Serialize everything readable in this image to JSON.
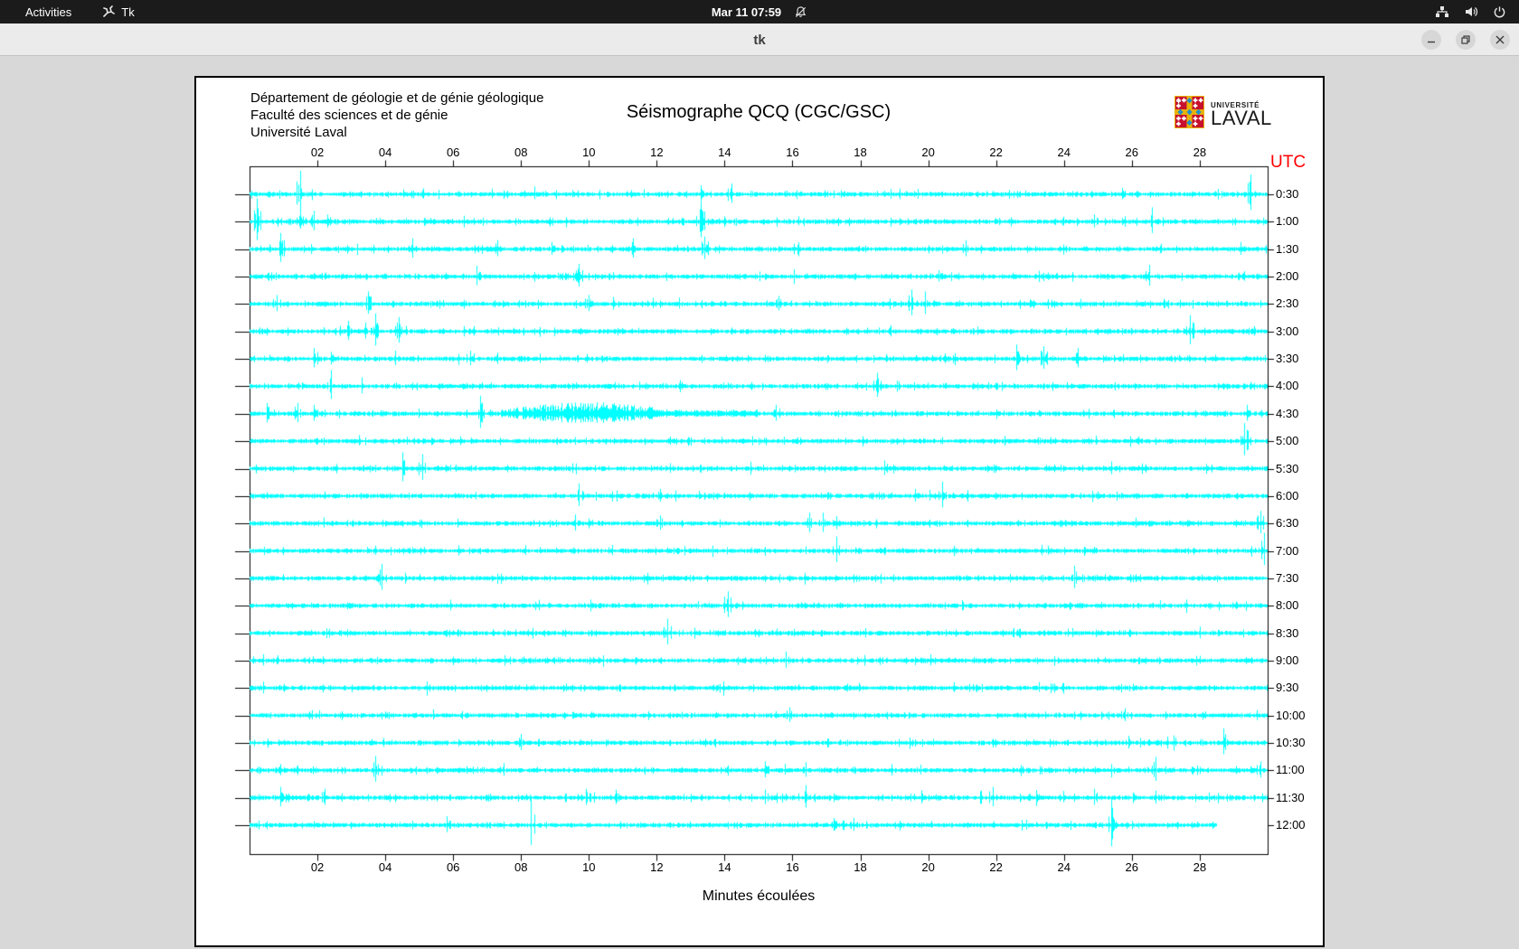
{
  "top_bar": {
    "activities_label": "Activities",
    "app_name": "Tk",
    "clock": "Mar 11  07:59",
    "icons": [
      "tk-icon",
      "notifications-disabled-icon",
      "network-wired-icon",
      "volume-icon",
      "power-icon"
    ]
  },
  "window": {
    "title": "tk",
    "controls": [
      "minimize",
      "maximize",
      "close"
    ]
  },
  "chart_data": {
    "type": "line",
    "subtype": "helicorder-seismogram",
    "header_lines": "Département de géologie et de génie géologique\nFaculté des sciences et de génie\nUniversité Laval",
    "title": "Séismographe QCQ (CGC/GSC)",
    "logo": {
      "line1": "UNIVERSITÉ",
      "line2": "LAVAL"
    },
    "right_axis_label": "UTC",
    "xlabel": "Minutes écoulées",
    "x_ticks": [
      "02",
      "04",
      "06",
      "08",
      "10",
      "12",
      "14",
      "16",
      "18",
      "20",
      "22",
      "24",
      "26",
      "28"
    ],
    "x_tick_minutes": [
      2,
      4,
      6,
      8,
      10,
      12,
      14,
      16,
      18,
      20,
      22,
      24,
      26,
      28
    ],
    "x_range_minutes": [
      0,
      30
    ],
    "trace_color": "#00ffff",
    "axis_color": "#000000",
    "utc_color": "#ff0000",
    "rows": [
      {
        "label": "0:30",
        "end": 30,
        "events": [
          [
            1.5,
            26
          ],
          [
            13.3,
            10
          ],
          [
            14.2,
            12
          ],
          [
            19.7,
            6
          ],
          [
            25.7,
            7
          ],
          [
            29.5,
            22
          ]
        ]
      },
      {
        "label": "1:00",
        "end": 30,
        "events": [
          [
            0.2,
            26
          ],
          [
            1.5,
            10
          ],
          [
            1.9,
            12
          ],
          [
            2.3,
            8
          ],
          [
            13.3,
            22
          ],
          [
            24.9,
            8
          ],
          [
            26.6,
            16
          ]
        ]
      },
      {
        "label": "1:30",
        "end": 30,
        "events": [
          [
            0.9,
            18
          ],
          [
            4.8,
            12
          ],
          [
            7.3,
            10
          ],
          [
            8.9,
            8
          ],
          [
            11.3,
            12
          ],
          [
            13.4,
            14
          ],
          [
            21.1,
            10
          ],
          [
            29.2,
            8
          ]
        ]
      },
      {
        "label": "2:00",
        "end": 30,
        "events": [
          [
            6.7,
            12
          ],
          [
            9.7,
            14
          ],
          [
            20.3,
            7
          ],
          [
            26.5,
            13
          ],
          [
            29.3,
            6
          ]
        ]
      },
      {
        "label": "2:30",
        "end": 30,
        "events": [
          [
            0.8,
            10
          ],
          [
            3.5,
            14
          ],
          [
            10.0,
            10
          ],
          [
            10.7,
            8
          ],
          [
            15.6,
            9
          ],
          [
            19.5,
            16
          ],
          [
            19.9,
            14
          ],
          [
            23.0,
            5
          ]
        ]
      },
      {
        "label": "3:00",
        "end": 30,
        "events": [
          [
            2.9,
            12
          ],
          [
            3.4,
            10
          ],
          [
            3.7,
            20
          ],
          [
            4.4,
            16
          ],
          [
            6.6,
            6
          ],
          [
            18.9,
            7
          ],
          [
            27.7,
            18
          ],
          [
            29.6,
            6
          ]
        ]
      },
      {
        "label": "3:30",
        "end": 30,
        "events": [
          [
            1.9,
            12
          ],
          [
            2.4,
            8
          ],
          [
            4.3,
            9
          ],
          [
            6.5,
            9
          ],
          [
            7.3,
            7
          ],
          [
            20.5,
            6
          ],
          [
            22.6,
            16
          ],
          [
            23.4,
            14
          ],
          [
            24.4,
            12
          ]
        ]
      },
      {
        "label": "4:00",
        "end": 30,
        "events": [
          [
            2.4,
            18
          ],
          [
            3.3,
            10
          ],
          [
            18.5,
            15
          ],
          [
            29.5,
            5
          ]
        ]
      },
      {
        "label": "4:30",
        "end": 30,
        "events": [
          [
            0.5,
            12
          ],
          [
            1.4,
            12
          ],
          [
            1.9,
            10
          ],
          [
            6.8,
            20
          ],
          [
            15.5,
            10
          ],
          [
            29.4,
            10
          ]
        ],
        "bursts": [
          [
            7.4,
            15.0,
            13
          ]
        ]
      },
      {
        "label": "5:00",
        "end": 30,
        "events": [
          [
            12.4,
            5
          ],
          [
            26.2,
            5
          ],
          [
            29.3,
            20
          ]
        ]
      },
      {
        "label": "5:30",
        "end": 30,
        "events": [
          [
            4.5,
            18
          ],
          [
            5.1,
            16
          ],
          [
            12.4,
            6
          ],
          [
            18.7,
            9
          ],
          [
            25.4,
            8
          ]
        ]
      },
      {
        "label": "6:00",
        "end": 30,
        "events": [
          [
            9.7,
            14
          ],
          [
            12.1,
            8
          ],
          [
            19.6,
            8
          ],
          [
            20.4,
            16
          ],
          [
            25.0,
            5
          ]
        ]
      },
      {
        "label": "6:30",
        "end": 30,
        "events": [
          [
            9.6,
            10
          ],
          [
            12.1,
            9
          ],
          [
            16.5,
            12
          ],
          [
            16.9,
            12
          ],
          [
            17.3,
            8
          ],
          [
            29.8,
            14
          ]
        ]
      },
      {
        "label": "7:00",
        "end": 30,
        "events": [
          [
            17.3,
            16
          ],
          [
            29.9,
            20
          ]
        ]
      },
      {
        "label": "7:30",
        "end": 30,
        "events": [
          [
            3.9,
            16
          ],
          [
            24.3,
            14
          ]
        ]
      },
      {
        "label": "8:00",
        "end": 30,
        "events": [
          [
            14.1,
            16
          ]
        ]
      },
      {
        "label": "8:30",
        "end": 30,
        "events": [
          [
            12.3,
            16
          ]
        ]
      },
      {
        "label": "9:00",
        "end": 30,
        "events": [
          [
            15.8,
            10
          ]
        ]
      },
      {
        "label": "9:30",
        "end": 30,
        "events": [
          [
            17.6,
            5
          ]
        ]
      },
      {
        "label": "10:00",
        "end": 30,
        "events": [
          [
            15.9,
            9
          ],
          [
            25.8,
            8
          ]
        ]
      },
      {
        "label": "10:30",
        "end": 30,
        "events": [
          [
            8.0,
            10
          ],
          [
            25.9,
            8
          ],
          [
            28.7,
            16
          ]
        ]
      },
      {
        "label": "11:00",
        "end": 30,
        "events": [
          [
            0.9,
            7
          ],
          [
            3.7,
            16
          ],
          [
            7.5,
            8
          ],
          [
            15.2,
            10
          ],
          [
            16.4,
            9
          ],
          [
            26.7,
            15
          ],
          [
            29.8,
            10
          ]
        ]
      },
      {
        "label": "11:30",
        "end": 30,
        "events": [
          [
            0.9,
            12
          ],
          [
            2.2,
            10
          ],
          [
            9.9,
            10
          ],
          [
            10.8,
            9
          ],
          [
            15.2,
            9
          ],
          [
            16.4,
            14
          ],
          [
            19.8,
            8
          ],
          [
            21.9,
            12
          ],
          [
            24.9,
            10
          ],
          [
            26.7,
            8
          ]
        ]
      },
      {
        "label": "12:00",
        "end": 28.5,
        "events": [
          [
            5.8,
            10
          ],
          [
            8.3,
            28
          ],
          [
            17.2,
            8
          ],
          [
            17.8,
            8
          ],
          [
            25.4,
            30
          ]
        ]
      }
    ]
  }
}
